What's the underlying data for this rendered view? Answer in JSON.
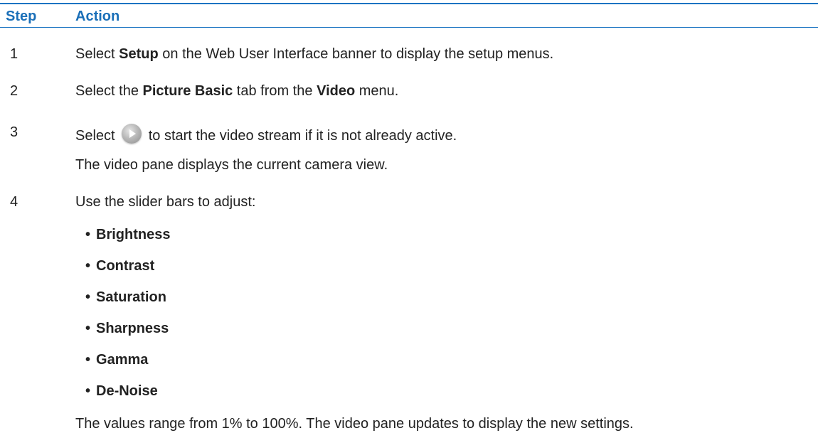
{
  "table": {
    "headers": {
      "step": "Step",
      "action": "Action"
    },
    "colors": {
      "header_text": "#1a6fb8",
      "rule": "#1a73c2",
      "play_icon": "#a0a0a0"
    },
    "steps": [
      {
        "number": "1",
        "segments": [
          "Select ",
          "Setup",
          " on the Web User Interface banner to display the setup menus."
        ]
      },
      {
        "number": "2",
        "segments": [
          "Select the ",
          "Picture Basic",
          " tab from the ",
          "Video",
          " menu."
        ]
      },
      {
        "number": "3",
        "before_icon": "Select ",
        "icon": "play-icon",
        "after_icon": " to start the video stream if it is not already active.",
        "note": "The video pane displays the current camera view."
      },
      {
        "number": "4",
        "text": "Use the slider bars to adjust:",
        "bullets": [
          "Brightness",
          "Contrast",
          "Saturation",
          "Sharpness",
          "Gamma",
          "De-Noise"
        ],
        "note": "The values range from 1% to 100%. The video pane updates to display the new settings."
      }
    ]
  }
}
